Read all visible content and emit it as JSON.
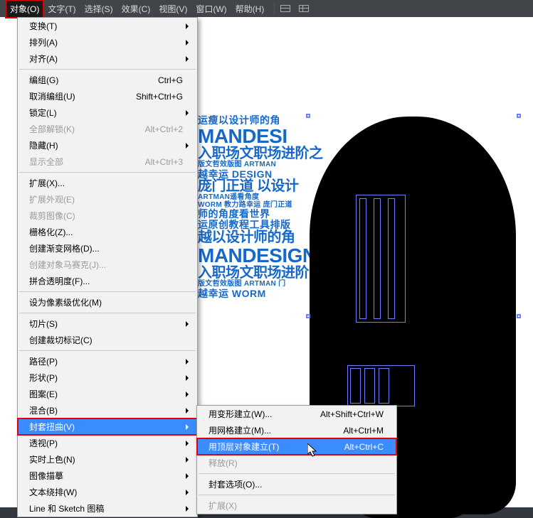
{
  "menubar": {
    "items": [
      "对象(O)",
      "文字(T)",
      "选择(S)",
      "效果(C)",
      "视图(V)",
      "窗口(W)",
      "帮助(H)"
    ],
    "activeIndex": 0
  },
  "objectMenu": {
    "groups": [
      [
        {
          "label": "变换(T)",
          "arrow": true
        },
        {
          "label": "排列(A)",
          "arrow": true
        },
        {
          "label": "对齐(A)",
          "arrow": true
        }
      ],
      [
        {
          "label": "编组(G)",
          "shortcut": "Ctrl+G"
        },
        {
          "label": "取消编组(U)",
          "shortcut": "Shift+Ctrl+G"
        },
        {
          "label": "锁定(L)",
          "arrow": true
        },
        {
          "label": "全部解锁(K)",
          "shortcut": "Alt+Ctrl+2",
          "disabled": true
        },
        {
          "label": "隐藏(H)",
          "arrow": true
        },
        {
          "label": "显示全部",
          "shortcut": "Alt+Ctrl+3",
          "disabled": true
        }
      ],
      [
        {
          "label": "扩展(X)..."
        },
        {
          "label": "扩展外观(E)",
          "disabled": true
        },
        {
          "label": "裁剪图像(C)",
          "disabled": true
        },
        {
          "label": "栅格化(Z)..."
        },
        {
          "label": "创建渐变网格(D)..."
        },
        {
          "label": "创建对象马赛克(J)...",
          "disabled": true
        },
        {
          "label": "拼合透明度(F)..."
        }
      ],
      [
        {
          "label": "设为像素级优化(M)"
        }
      ],
      [
        {
          "label": "切片(S)",
          "arrow": true
        },
        {
          "label": "创建裁切标记(C)"
        }
      ],
      [
        {
          "label": "路径(P)",
          "arrow": true
        },
        {
          "label": "形状(P)",
          "arrow": true
        },
        {
          "label": "图案(E)",
          "arrow": true
        },
        {
          "label": "混合(B)",
          "arrow": true
        },
        {
          "label": "封套扭曲(V)",
          "arrow": true,
          "highlight": true,
          "redbox": true
        },
        {
          "label": "透视(P)",
          "arrow": true
        },
        {
          "label": "实时上色(N)",
          "arrow": true
        },
        {
          "label": "图像描摹",
          "arrow": true
        },
        {
          "label": "文本绕排(W)",
          "arrow": true
        },
        {
          "label": "Line 和 Sketch 图稿",
          "arrow": true
        }
      ]
    ]
  },
  "envelopeSubmenu": {
    "groups": [
      [
        {
          "label": "用变形建立(W)...",
          "shortcut": "Alt+Shift+Ctrl+W"
        },
        {
          "label": "用网格建立(M)...",
          "shortcut": "Alt+Ctrl+M"
        },
        {
          "label": "用顶层对象建立(T)",
          "shortcut": "Alt+Ctrl+C",
          "highlight": true,
          "redbox": true
        },
        {
          "label": "释放(R)",
          "disabled": true
        }
      ],
      [
        {
          "label": "封套选项(O)..."
        }
      ],
      [
        {
          "label": "扩展(X)",
          "disabled": true
        }
      ]
    ]
  },
  "canvasText": {
    "l0": "运瘦以设计师的角",
    "l1": "MANDESI",
    "l2": "入职场文职场进阶之",
    "l3": "版文哲效版图 ARTMAN",
    "l4": "越幸运 DESIGN",
    "l5": "庞门正道 以设计",
    "l6": "ARTMAN遥看角度",
    "l7": "WORM 教力路幸运 庞门正道",
    "l8": "师的角度看世界",
    "l9": "运原创教程工具排版",
    "l10": "越以设计师的角",
    "l11": "MANDESIGN",
    "l12": "入职场文职场进阶 庞",
    "l13": "版文哲效版图 ARTMAN 门",
    "l14": "越幸运 WORM"
  }
}
